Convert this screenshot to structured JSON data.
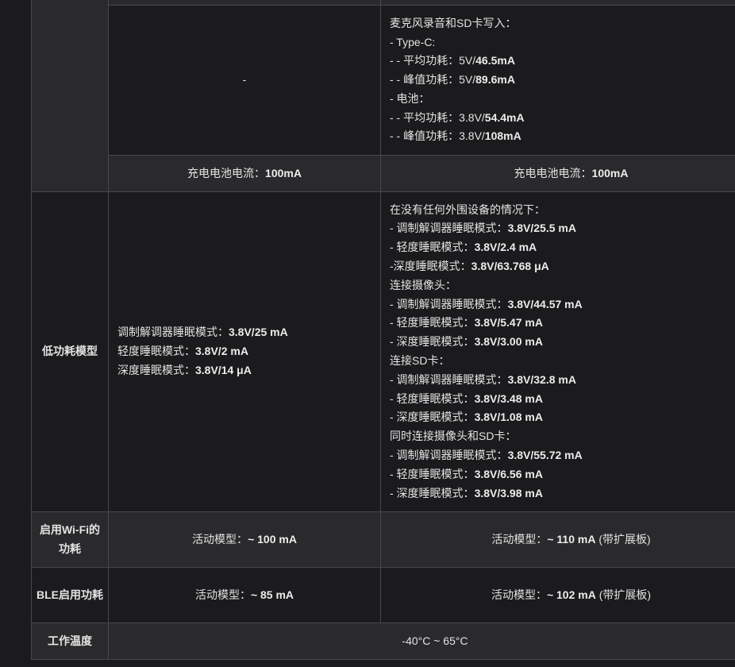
{
  "rows": {
    "partial": {
      "c2": "",
      "c3": ""
    },
    "mic_sd": {
      "c2": "-",
      "lines": [
        {
          "t": "麦克风录音和SD卡写入：",
          "b": ""
        },
        {
          "t": "- Type-C:",
          "b": ""
        },
        {
          "t": "- - 平均功耗：5V/",
          "b": "46.5mA"
        },
        {
          "t": "- - 峰值功耗：5V/",
          "b": "89.6mA"
        },
        {
          "t": "- 电池：",
          "b": ""
        },
        {
          "t": "- - 平均功耗：3.8V/",
          "b": "54.4mA"
        },
        {
          "t": "- - 峰值功耗：3.8V/",
          "b": "108mA"
        }
      ]
    },
    "charge": {
      "c2_label": "充电电池电流：",
      "c2_value": "100mA",
      "c3_label": "充电电池电流：",
      "c3_value": "100mA"
    },
    "low_power": {
      "header": "低功耗模型",
      "c2_lines": [
        {
          "t": "调制解调器睡眠模式：",
          "b": "3.8V/25 mA"
        },
        {
          "t": "轻度睡眠模式：",
          "b": "3.8V/2 mA"
        },
        {
          "t": "深度睡眠模式：",
          "b": "3.8V/14 μA"
        }
      ],
      "c3_lines": [
        {
          "t": "在没有任何外围设备的情况下：",
          "b": ""
        },
        {
          "t": "- 调制解调器睡眠模式：",
          "b": "3.8V/25.5 mA"
        },
        {
          "t": "- 轻度睡眠模式：",
          "b": "3.8V/2.4 mA"
        },
        {
          "t": "-深度睡眠模式：",
          "b": "3.8V/63.768 μA"
        },
        {
          "t": "连接摄像头：",
          "b": ""
        },
        {
          "t": "- 调制解调器睡眠模式：",
          "b": "3.8V/44.57 mA"
        },
        {
          "t": "- 轻度睡眠模式：",
          "b": "3.8V/5.47 mA"
        },
        {
          "t": "- 深度睡眠模式：",
          "b": "3.8V/3.00 mA"
        },
        {
          "t": "连接SD卡：",
          "b": ""
        },
        {
          "t": "- 调制解调器睡眠模式：",
          "b": "3.8V/32.8 mA"
        },
        {
          "t": "- 轻度睡眠模式：",
          "b": "3.8V/3.48 mA"
        },
        {
          "t": "- 深度睡眠模式：",
          "b": "3.8V/1.08 mA"
        },
        {
          "t": "同时连接摄像头和SD卡：",
          "b": ""
        },
        {
          "t": "- 调制解调器睡眠模式：",
          "b": "3.8V/55.72 mA"
        },
        {
          "t": "- 轻度睡眠模式：",
          "b": "3.8V/6.56 mA"
        },
        {
          "t": "- 深度睡眠模式：",
          "b": "3.8V/3.98 mA"
        }
      ]
    },
    "wifi": {
      "header": "启用Wi-Fi的功耗",
      "c2_label": "活动模型：",
      "c2_value": "~ 100 mA",
      "c3_label": "活动模型：",
      "c3_value": "~ 110 mA",
      "c3_suffix": " (带扩展板)"
    },
    "ble": {
      "header": "BLE启用功耗",
      "c2_label": "活动模型：",
      "c2_value": "~ 85 mA",
      "c3_label": "活动模型：",
      "c3_value": "~ 102 mA",
      "c3_suffix": " (带扩展板)"
    },
    "temp": {
      "header": "工作温度",
      "value": "-40°C ~ 65°C"
    }
  }
}
